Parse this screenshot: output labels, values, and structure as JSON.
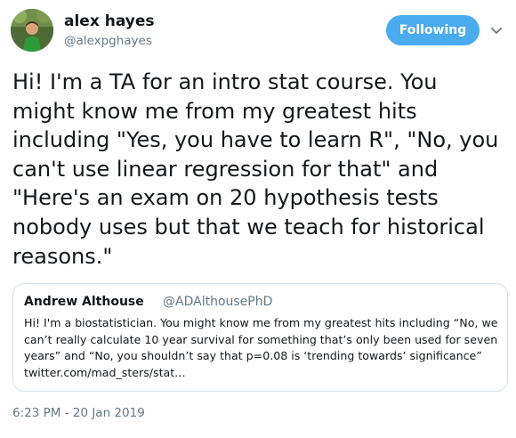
{
  "author": {
    "name": "alex hayes",
    "handle": "@alexpghayes"
  },
  "follow_button": {
    "label": "Following",
    "color": "#4aabee"
  },
  "menu_icon": "chevron-down-icon",
  "tweet": {
    "lines": [
      "Hi! I'm a TA for an intro stat course. You",
      "might know me from my greatest hits",
      "including \"Yes, you have to learn R\", \"No, you",
      "can't use linear regression for that\" and",
      "\"Here's an exam on 20 hypothesis tests",
      "nobody uses but that we teach for historical",
      "reasons.\""
    ]
  },
  "quoted_tweet": {
    "name": "Andrew Althouse",
    "handle": "@ADAlthousePhD",
    "lines": [
      "Hi! I'm a biostatistician. You might know me from my greatest hits including “No, we",
      "can’t really calculate 10 year survival for something that’s only been used for seven",
      "years” and “No, you shouldn’t say that p=0.08 is ‘trending towards’ significance”",
      "twitter.com/mad_sters/stat…"
    ]
  },
  "timestamp": "6:23 PM - 20 Jan 2019",
  "colors": {
    "text": "#14171a",
    "secondary": "#657786",
    "border": "#d9e1e8"
  }
}
